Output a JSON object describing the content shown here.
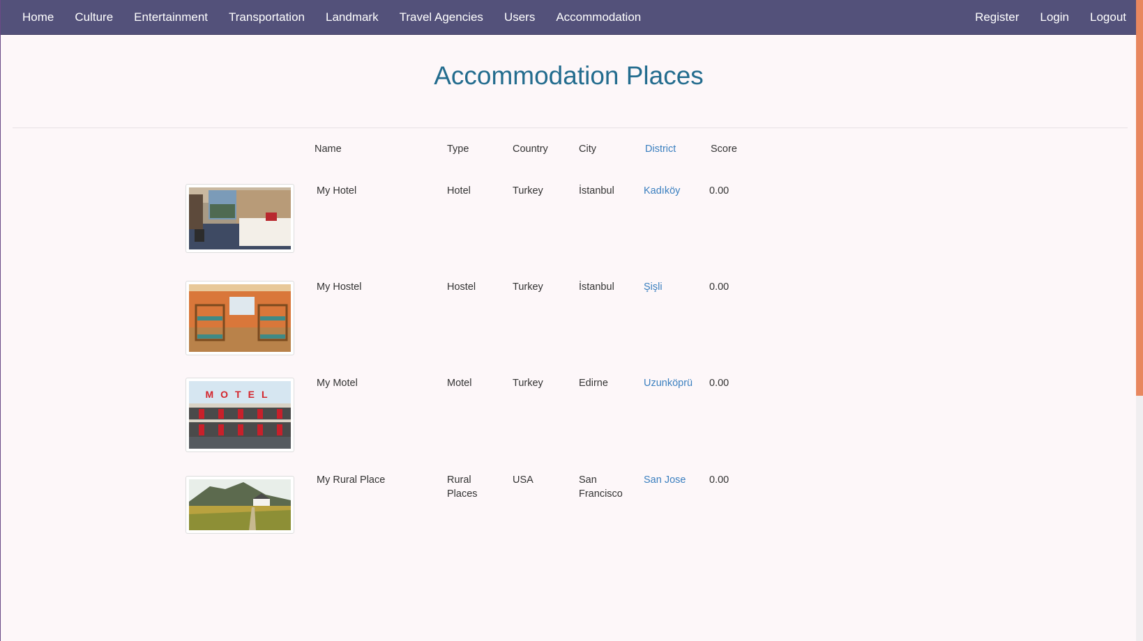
{
  "nav": {
    "left": [
      "Home",
      "Culture",
      "Entertainment",
      "Transportation",
      "Landmark",
      "Travel Agencies",
      "Users",
      "Accommodation"
    ],
    "right": [
      "Register",
      "Login",
      "Logout"
    ]
  },
  "page": {
    "title": "Accommodation Places"
  },
  "table": {
    "headers": {
      "name": "Name",
      "type": "Type",
      "country": "Country",
      "city": "City",
      "district": "District",
      "score": "Score"
    },
    "rows": [
      {
        "name": "My Hotel",
        "type": "Hotel",
        "country": "Turkey",
        "city": "İstanbul",
        "district": "Kadıköy",
        "score": "0.00",
        "image": "hotel-room-photo"
      },
      {
        "name": "My Hostel",
        "type": "Hostel",
        "country": "Turkey",
        "city": "İstanbul",
        "district": "Şişli",
        "score": "0.00",
        "image": "hostel-room-photo"
      },
      {
        "name": "My Motel",
        "type": "Motel",
        "country": "Turkey",
        "city": "Edirne",
        "district": "Uzunköprü",
        "score": "0.00",
        "image": "motel-building-photo",
        "sign_text": "MOTEL"
      },
      {
        "name": "My Rural Place",
        "type": "Rural Places",
        "country": "USA",
        "city": "San Francisco",
        "district": "San Jose",
        "score": "0.00",
        "image": "rural-landscape-photo"
      }
    ]
  },
  "colors": {
    "navbar": "#53517a",
    "title": "#236c8e",
    "link": "#3a7fbf",
    "scrollbar": "#e8875f",
    "background": "#fdf7f9"
  }
}
